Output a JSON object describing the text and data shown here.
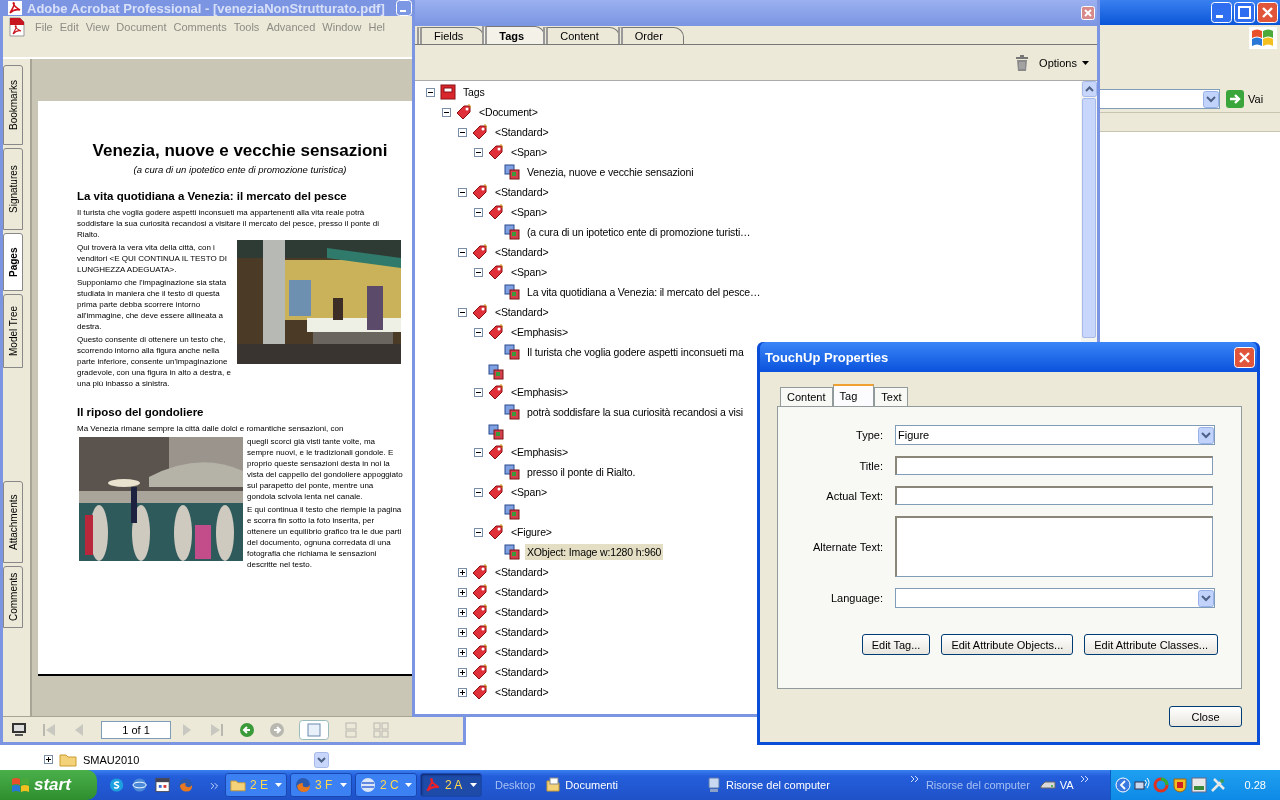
{
  "explorer": {
    "go_button": "Vai",
    "tree_item": "SMAU2010"
  },
  "acrobat": {
    "title": "Adobe Acrobat Professional - [veneziaNonStrutturato.pdf]",
    "menu": [
      "File",
      "Edit",
      "View",
      "Document",
      "Comments",
      "Tools",
      "Advanced",
      "Window",
      "Hel"
    ],
    "side_tabs": [
      {
        "label": "Bookmarks",
        "selected": false
      },
      {
        "label": "Signatures",
        "selected": false
      },
      {
        "label": "Pages",
        "selected": true
      },
      {
        "label": "Model Tree",
        "selected": false
      },
      {
        "label": "Attachments",
        "selected": false
      },
      {
        "label": "Comments",
        "selected": false
      }
    ],
    "page": {
      "title": "Venezia, nuove e vecchie sensazioni",
      "subtitle": "(a cura di un ipotetico ente di promozione turistica)",
      "sections": [
        {
          "heading": "La vita quotidiana a Venezia: il mercato del pesce",
          "intro": "Il turista che voglia godere aspetti inconsueti ma appartenenti alla vita reale potrà soddisfare la sua curiosità recandosi a visitare il mercato del pesce, presso il ponte di Rialto.",
          "paragraphs": [
            "Qui troverà la vera vita della città, con i venditori <E QUI CONTINUA IL TESTO DI LUNGHEZZA ADEGUATA>.",
            "Supponiamo che l'impaginazione sia stata studiata in maniera che il testo di questa prima parte debba scorrere intorno all'immagine, che deve essere allineata a destra.",
            "Questo consente di ottenere un testo che, scorrendo intorno alla figura anche nella parte inferiore, consente un'impaginazione gradevole, con una figura in alto a destra, e una più inbasso a sinistra."
          ]
        },
        {
          "heading": "Il riposo del gondoliere",
          "intro": "Ma Venezia rimane sempre la città dalle dolci e romantiche sensazioni, con",
          "paragraphs": [
            "quegli scorci già visti tante volte, ma sempre nuovi, e le tradizionali gondole. E proprio queste sensazioni desta in noi la vista del cappello del gondoliere appoggiato sul parapetto del ponte, mentre una gondola scivola lenta nel canale.",
            "E qui continua il testo che riempie la pagina e scorra fin sotto la foto inserita, per ottenere un equilibrio grafico tra le due parti del documento, ognuna corredata di una fotografia che richiama le sensazioni descritte nel testo."
          ]
        }
      ]
    },
    "nav": {
      "page_field": "1 of 1"
    }
  },
  "tags_panel": {
    "tabs": [
      {
        "label": "Fields",
        "selected": false
      },
      {
        "label": "Tags",
        "selected": true
      },
      {
        "label": "Content",
        "selected": false
      },
      {
        "label": "Order",
        "selected": false
      }
    ],
    "options": "Options",
    "tree": [
      {
        "label": "Tags",
        "kind": "root",
        "expanded": true,
        "selected": false,
        "children": [
          {
            "label": "<Document>",
            "kind": "tag",
            "expanded": true,
            "selected": false,
            "children": [
              {
                "label": "<Standard>",
                "kind": "tag",
                "expanded": true,
                "selected": false,
                "children": [
                  {
                    "label": "<Span>",
                    "kind": "tag",
                    "expanded": true,
                    "selected": false,
                    "children": [
                      {
                        "label": "Venezia, nuove e vecchie sensazioni",
                        "kind": "content",
                        "selected": false
                      }
                    ]
                  }
                ]
              },
              {
                "label": "<Standard>",
                "kind": "tag",
                "expanded": true,
                "selected": false,
                "children": [
                  {
                    "label": "<Span>",
                    "kind": "tag",
                    "expanded": true,
                    "selected": false,
                    "children": [
                      {
                        "label": "(a cura di un ipotetico ente di promozione turisti…",
                        "kind": "content",
                        "selected": false
                      }
                    ]
                  }
                ]
              },
              {
                "label": "<Standard>",
                "kind": "tag",
                "expanded": true,
                "selected": false,
                "children": [
                  {
                    "label": "<Span>",
                    "kind": "tag",
                    "expanded": true,
                    "selected": false,
                    "children": [
                      {
                        "label": "La vita quotidiana a Venezia: il mercato del pesce…",
                        "kind": "content",
                        "selected": false
                      }
                    ]
                  }
                ]
              },
              {
                "label": "<Standard>",
                "kind": "tag",
                "expanded": true,
                "selected": false,
                "children": [
                  {
                    "label": "<Emphasis>",
                    "kind": "tag",
                    "expanded": true,
                    "selected": false,
                    "children": [
                      {
                        "label": "Il turista che voglia godere aspetti inconsueti ma",
                        "kind": "content",
                        "selected": false
                      }
                    ]
                  },
                  {
                    "kind": "content"
                  },
                  {
                    "label": "<Emphasis>",
                    "kind": "tag",
                    "expanded": true,
                    "selected": false,
                    "children": [
                      {
                        "label": "potrà soddisfare la sua curiosità recandosi a visi",
                        "kind": "content",
                        "selected": false
                      }
                    ]
                  },
                  {
                    "kind": "content"
                  },
                  {
                    "label": "<Emphasis>",
                    "kind": "tag",
                    "expanded": true,
                    "selected": false,
                    "children": [
                      {
                        "label": "presso il ponte di Rialto.",
                        "kind": "content",
                        "selected": false
                      }
                    ]
                  },
                  {
                    "label": "<Span>",
                    "kind": "tag",
                    "expanded": true,
                    "selected": false,
                    "children": [
                      {
                        "kind": "content"
                      }
                    ]
                  },
                  {
                    "label": "<Figure>",
                    "kind": "tag",
                    "expanded": true,
                    "selected": false,
                    "children": [
                      {
                        "label": "XObject:  Image  w:1280 h:960",
                        "kind": "content",
                        "selected": true
                      }
                    ]
                  }
                ]
              },
              {
                "label": "<Standard>",
                "kind": "tag",
                "expanded": false,
                "selected": false
              },
              {
                "label": "<Standard>",
                "kind": "tag",
                "expanded": false,
                "selected": false
              },
              {
                "label": "<Standard>",
                "kind": "tag",
                "expanded": false,
                "selected": false
              },
              {
                "label": "<Standard>",
                "kind": "tag",
                "expanded": false,
                "selected": false
              },
              {
                "label": "<Standard>",
                "kind": "tag",
                "expanded": false,
                "selected": false
              },
              {
                "label": "<Standard>",
                "kind": "tag",
                "expanded": false,
                "selected": false
              },
              {
                "label": "<Standard>",
                "kind": "tag",
                "expanded": false,
                "selected": false
              }
            ]
          }
        ]
      }
    ]
  },
  "dialog": {
    "title": "TouchUp Properties",
    "tabs": [
      {
        "label": "Content",
        "selected": false
      },
      {
        "label": "Tag",
        "selected": true
      },
      {
        "label": "Text",
        "selected": false
      }
    ],
    "fields": [
      {
        "label": "Type:",
        "kind": "select",
        "value": "Figure"
      },
      {
        "label": "Title:",
        "kind": "text"
      },
      {
        "label": "Actual Text:",
        "kind": "text"
      },
      {
        "label": "Alternate Text:",
        "kind": "textarea"
      },
      {
        "label": "Language:",
        "kind": "select"
      }
    ],
    "buttons": [
      "Edit Tag...",
      "Edit Attribute Objects...",
      "Edit Attribute Classes..."
    ],
    "close": "Close"
  },
  "taskbar": {
    "start": "start",
    "tasks": [
      {
        "label": "2 E",
        "selected": false
      },
      {
        "label": "3 F",
        "selected": false
      },
      {
        "label": "2 C",
        "selected": false
      },
      {
        "label": "2 A",
        "selected": true
      }
    ],
    "toolbars": [
      {
        "title": "Desktop",
        "items": [
          "Documenti",
          "Risorse del computer"
        ]
      },
      {
        "title": "Risorse del computer",
        "items": [
          "VA"
        ]
      }
    ],
    "clock": "0.28"
  }
}
